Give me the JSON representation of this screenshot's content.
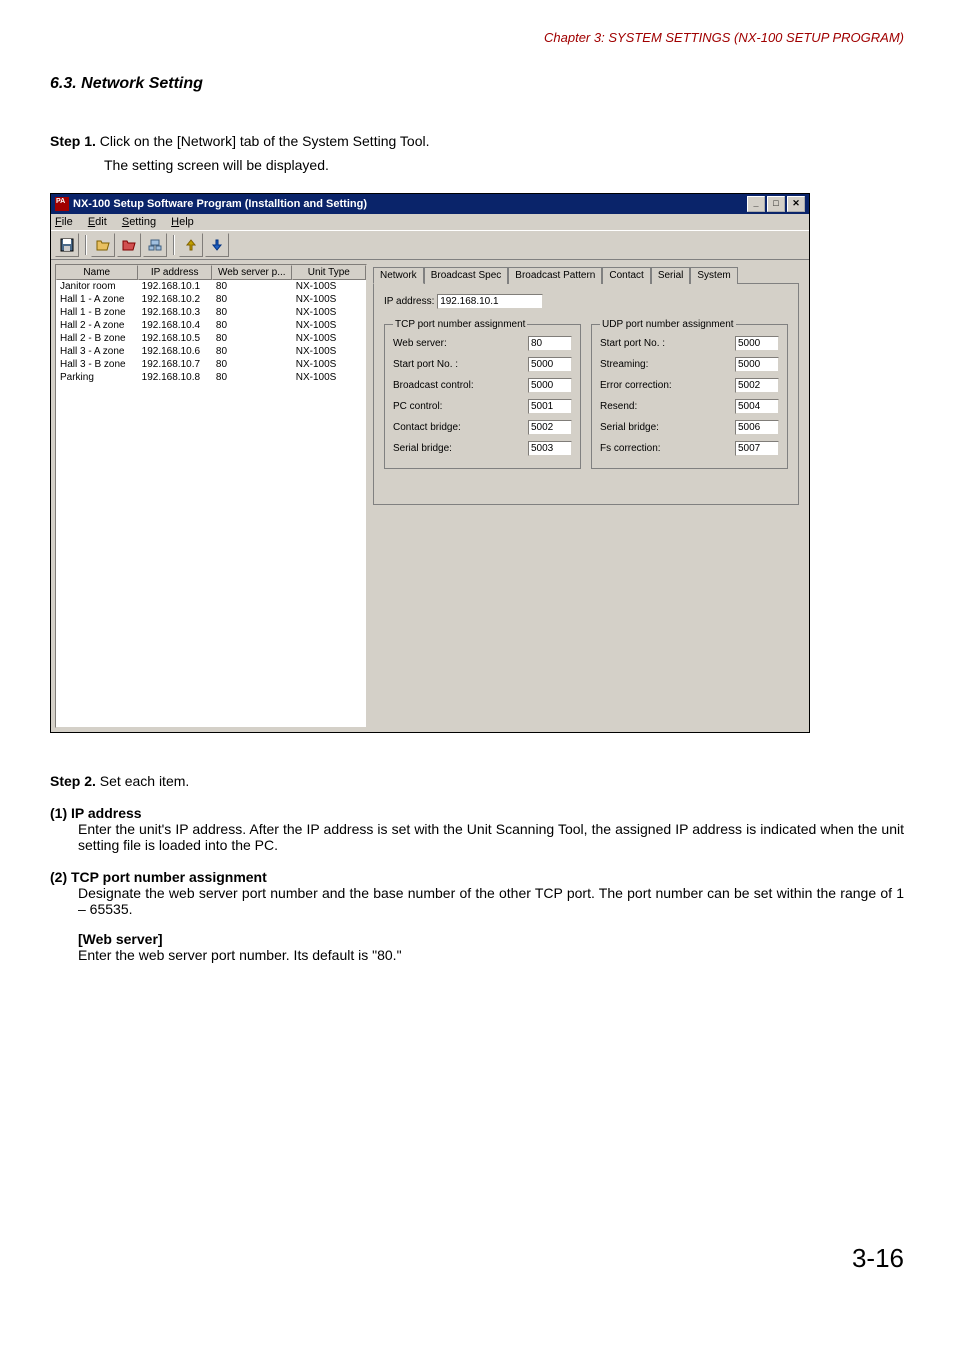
{
  "chapter": "Chapter 3:  SYSTEM SETTINGS (NX-100 SETUP PROGRAM)",
  "section": "6.3. Network Setting",
  "step1": {
    "label": "Step 1.",
    "line1": "Click on the [Network] tab of the System Setting Tool.",
    "line2": "The setting screen will be displayed."
  },
  "window": {
    "title": "NX-100 Setup Software Program (Installtion and Setting)",
    "menu": {
      "file": "File",
      "edit": "Edit",
      "setting": "Setting",
      "help": "Help"
    },
    "columns": {
      "name": "Name",
      "ip": "IP address",
      "web": "Web server p...",
      "type": "Unit Type"
    },
    "rows": [
      {
        "name": "Janitor room",
        "ip": "192.168.10.1",
        "web": "80",
        "type": "NX-100S"
      },
      {
        "name": "Hall 1 - A zone",
        "ip": "192.168.10.2",
        "web": "80",
        "type": "NX-100S"
      },
      {
        "name": "Hall 1 - B zone",
        "ip": "192.168.10.3",
        "web": "80",
        "type": "NX-100S"
      },
      {
        "name": "Hall 2 - A zone",
        "ip": "192.168.10.4",
        "web": "80",
        "type": "NX-100S"
      },
      {
        "name": "Hall 2 - B zone",
        "ip": "192.168.10.5",
        "web": "80",
        "type": "NX-100S"
      },
      {
        "name": "Hall 3 - A zone",
        "ip": "192.168.10.6",
        "web": "80",
        "type": "NX-100S"
      },
      {
        "name": "Hall 3 - B zone",
        "ip": "192.168.10.7",
        "web": "80",
        "type": "NX-100S"
      },
      {
        "name": "Parking",
        "ip": "192.168.10.8",
        "web": "80",
        "type": "NX-100S"
      }
    ],
    "tabs": {
      "network": "Network",
      "bspec": "Broadcast Spec",
      "bpattern": "Broadcast Pattern",
      "contact": "Contact",
      "serial": "Serial",
      "system": "System"
    },
    "ip_label": "IP address:",
    "ip_value": "192.168.10.1",
    "tcp": {
      "legend": "TCP port number assignment",
      "fields": [
        {
          "label": "Web server:",
          "value": "80"
        },
        {
          "label": "Start port No. :",
          "value": "5000"
        },
        {
          "label": "Broadcast control:",
          "value": "5000"
        },
        {
          "label": "PC control:",
          "value": "5001"
        },
        {
          "label": "Contact bridge:",
          "value": "5002"
        },
        {
          "label": "Serial bridge:",
          "value": "5003"
        }
      ]
    },
    "udp": {
      "legend": "UDP port number assignment",
      "fields": [
        {
          "label": "Start port No. :",
          "value": "5000"
        },
        {
          "label": "Streaming:",
          "value": "5000"
        },
        {
          "label": "Error correction:",
          "value": "5002"
        },
        {
          "label": "Resend:",
          "value": "5004"
        },
        {
          "label": "Serial bridge:",
          "value": "5006"
        },
        {
          "label": "Fs correction:",
          "value": "5007"
        }
      ]
    }
  },
  "step2": {
    "label": "Step 2.",
    "text": "Set each item."
  },
  "items": {
    "i1": {
      "label": "(1)  IP address",
      "body": "Enter the unit's IP address. After the IP address is set with the Unit Scanning Tool, the assigned IP address is indicated when the unit setting file is loaded into the PC."
    },
    "i2": {
      "label": "(2)  TCP port number assignment",
      "body": "Designate the web server port number and the base number of the other TCP port. The port number can be set within the range of 1 – 65535.",
      "sub_label": "[Web server]",
      "sub_body": "Enter the web server port number. Its default is \"80.\""
    }
  },
  "page_num": "3-16"
}
